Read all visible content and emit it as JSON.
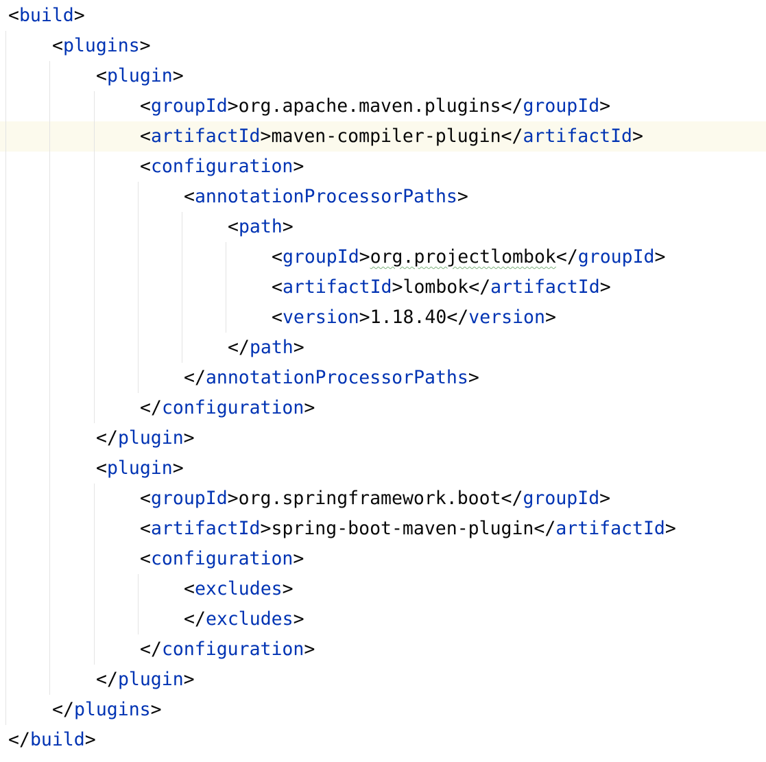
{
  "editor": {
    "language": "xml",
    "colors": {
      "background": "#ffffff",
      "tag_name": "#0033b3",
      "brackets_and_text": "#080808",
      "indent_guide": "#e3e3e3",
      "caret_row_highlight": "#fcfaed",
      "typo_underline": "#7fb37f"
    },
    "caret_line": 5,
    "lines": [
      {
        "no": 1,
        "indent": 0,
        "kind": "open",
        "tag": "build"
      },
      {
        "no": 2,
        "indent": 1,
        "kind": "open",
        "tag": "plugins"
      },
      {
        "no": 3,
        "indent": 2,
        "kind": "open",
        "tag": "plugin"
      },
      {
        "no": 4,
        "indent": 3,
        "kind": "value",
        "tag": "groupId",
        "text": "org.apache.maven.plugins"
      },
      {
        "no": 5,
        "indent": 3,
        "kind": "value",
        "tag": "artifactId",
        "text": "maven-compiler-plugin"
      },
      {
        "no": 6,
        "indent": 3,
        "kind": "open",
        "tag": "configuration"
      },
      {
        "no": 7,
        "indent": 4,
        "kind": "open",
        "tag": "annotationProcessorPaths"
      },
      {
        "no": 8,
        "indent": 5,
        "kind": "open",
        "tag": "path"
      },
      {
        "no": 9,
        "indent": 6,
        "kind": "value",
        "tag": "groupId",
        "text": "org.projectlombok",
        "typo": true
      },
      {
        "no": 10,
        "indent": 6,
        "kind": "value",
        "tag": "artifactId",
        "text": "lombok"
      },
      {
        "no": 11,
        "indent": 6,
        "kind": "value",
        "tag": "version",
        "text": "1.18.40"
      },
      {
        "no": 12,
        "indent": 5,
        "kind": "close",
        "tag": "path"
      },
      {
        "no": 13,
        "indent": 4,
        "kind": "close",
        "tag": "annotationProcessorPaths"
      },
      {
        "no": 14,
        "indent": 3,
        "kind": "close",
        "tag": "configuration"
      },
      {
        "no": 15,
        "indent": 2,
        "kind": "close",
        "tag": "plugin"
      },
      {
        "no": 16,
        "indent": 2,
        "kind": "open",
        "tag": "plugin"
      },
      {
        "no": 17,
        "indent": 3,
        "kind": "value",
        "tag": "groupId",
        "text": "org.springframework.boot"
      },
      {
        "no": 18,
        "indent": 3,
        "kind": "value",
        "tag": "artifactId",
        "text": "spring-boot-maven-plugin"
      },
      {
        "no": 19,
        "indent": 3,
        "kind": "open",
        "tag": "configuration"
      },
      {
        "no": 20,
        "indent": 4,
        "kind": "open",
        "tag": "excludes"
      },
      {
        "no": 21,
        "indent": 4,
        "kind": "close",
        "tag": "excludes"
      },
      {
        "no": 22,
        "indent": 3,
        "kind": "close",
        "tag": "configuration"
      },
      {
        "no": 23,
        "indent": 2,
        "kind": "close",
        "tag": "plugin"
      },
      {
        "no": 24,
        "indent": 1,
        "kind": "close",
        "tag": "plugins"
      },
      {
        "no": 25,
        "indent": 0,
        "kind": "close",
        "tag": "build"
      }
    ]
  }
}
